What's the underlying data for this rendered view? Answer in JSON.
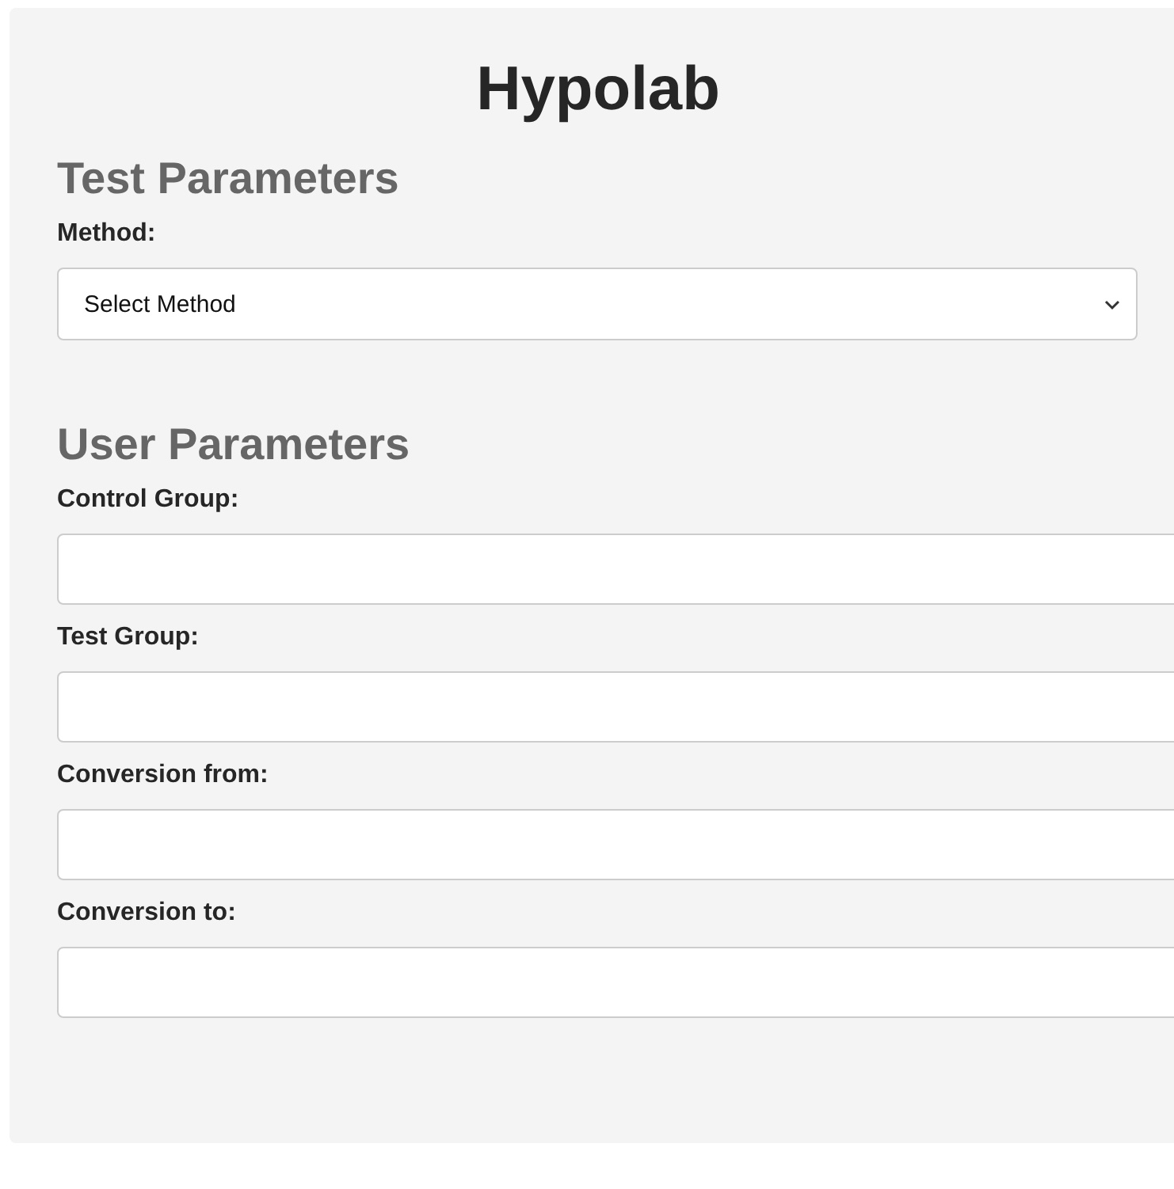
{
  "title": "Hypolab",
  "sections": [
    {
      "heading": "Test Parameters",
      "fields": [
        {
          "kind": "select",
          "label": "Method:",
          "value": "Select Method"
        }
      ]
    },
    {
      "heading": "User Parameters",
      "fields": [
        {
          "kind": "text",
          "label": "Control Group:"
        },
        {
          "kind": "text",
          "label": "Test Group:"
        },
        {
          "kind": "text",
          "label": "Conversion from:"
        },
        {
          "kind": "text",
          "label": "Conversion to:"
        }
      ]
    }
  ]
}
